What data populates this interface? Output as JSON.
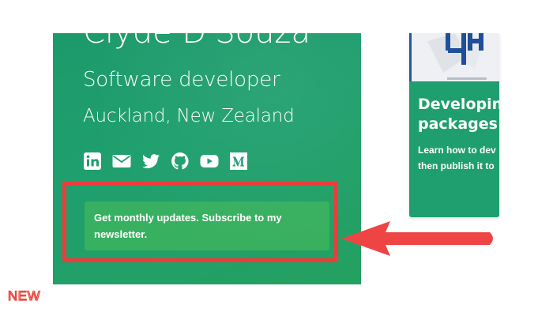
{
  "profile": {
    "name": "Clyde D'Souza",
    "role": "Software developer",
    "location": "Auckland, New Zealand",
    "social": [
      {
        "icon": "linkedin-icon",
        "name": "social-link-linkedin"
      },
      {
        "icon": "email-icon",
        "name": "social-link-email"
      },
      {
        "icon": "twitter-icon",
        "name": "social-link-twitter"
      },
      {
        "icon": "github-icon",
        "name": "social-link-github"
      },
      {
        "icon": "youtube-icon",
        "name": "social-link-youtube"
      },
      {
        "icon": "medium-icon",
        "name": "social-link-medium"
      }
    ],
    "newsletter_text": "Get monthly updates. Subscribe to my newsletter."
  },
  "article": {
    "title_line1": "Developin",
    "title_line2": "packages",
    "desc_line1": "Learn how to dev",
    "desc_line2": "then publish it to"
  },
  "badge": {
    "label": "NEW"
  },
  "colors": {
    "card_green": "#1f9e6f",
    "highlight_red": "#ef3b3b",
    "newsletter_green": "#3aae5e"
  }
}
